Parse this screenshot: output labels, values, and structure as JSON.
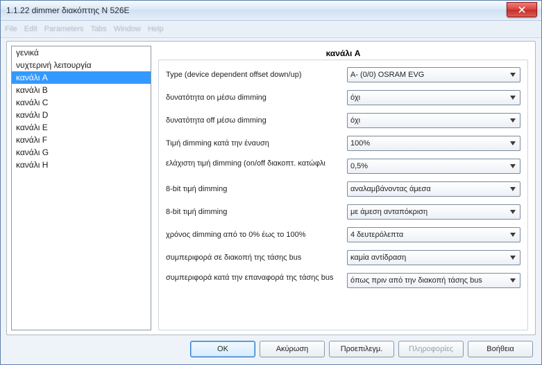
{
  "window": {
    "title": "1.1.22 dimmer διακόπτης N 526E"
  },
  "menubar": [
    "File",
    "Edit",
    "Parameters",
    "Tabs",
    "Window",
    "Help"
  ],
  "sidebar": {
    "items": [
      {
        "label": "γενικά"
      },
      {
        "label": "νυχτερινή λειτουργία"
      },
      {
        "label": "κανάλι A",
        "selected": true
      },
      {
        "label": "κανάλι B"
      },
      {
        "label": "κανάλι C"
      },
      {
        "label": "κανάλι D"
      },
      {
        "label": "κανάλι E"
      },
      {
        "label": "κανάλι F"
      },
      {
        "label": "κανάλι G"
      },
      {
        "label": "κανάλι H"
      }
    ]
  },
  "main": {
    "title": "κανάλι A",
    "rows": [
      {
        "label": "Type (device dependent offset down/up)",
        "value": "A- (0/0) OSRAM EVG"
      },
      {
        "label": "δυνατότητα on μέσω dimming",
        "value": "όχι"
      },
      {
        "label": "δυνατότητα off μέσω dimming",
        "value": "όχι"
      },
      {
        "label": "Τιμή dimming κατά την έναυση",
        "value": "100%"
      },
      {
        "label": "ελάχιστη τιμή dimming (on/off διακοπτ. κατώφλι",
        "value": "0,5%"
      },
      {
        "label": "8-bit τιμή dimming",
        "value": "αναλαμβάνοντας άμεσα"
      },
      {
        "label": "8-bit τιμή dimming",
        "value": "με άμεση ανταπόκριση"
      },
      {
        "label": "χρόνος dimming από το 0% έως το 100%",
        "value": "4 δευτερόλεπτα"
      },
      {
        "label": "συμπεριφορά σε διακοπή της τάσης bus",
        "value": "καμία αντίδραση"
      },
      {
        "label": "συμπεριφορά κατά την επαναφορά της τάσης bus",
        "value": "όπως πριν από την  διακοπή τάσης bus"
      }
    ]
  },
  "footer": {
    "ok": "OK",
    "cancel": "Ακύρωση",
    "default": "Προεπιλεγμ.",
    "info": "Πληροφορίες",
    "help": "Βοήθεια"
  }
}
